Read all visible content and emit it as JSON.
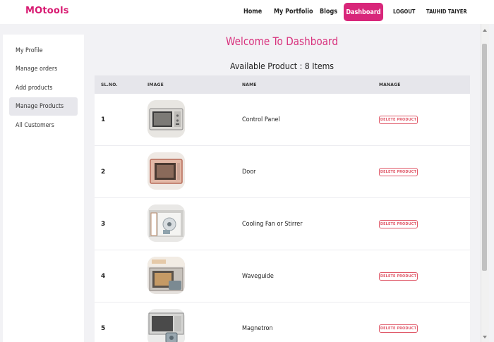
{
  "navbar": {
    "brand": "MOtools",
    "links": {
      "home": "Home",
      "portfolio": "My Portfolio",
      "blogs": "Blogs",
      "dashboard": "Dashboard",
      "logout": "LOGOUT",
      "user": "TAUHID TAIYER"
    }
  },
  "sidebar": {
    "items": [
      {
        "label": "My Profile"
      },
      {
        "label": "Manage orders"
      },
      {
        "label": "Add products"
      },
      {
        "label": "Manage Products",
        "active": true
      },
      {
        "label": "All Customers"
      }
    ]
  },
  "main": {
    "title": "Welcome To Dashboard",
    "subtitle": "Available Product : 8 Items"
  },
  "table": {
    "headers": {
      "slno": "SL.NO.",
      "image": "IMAGE",
      "name": "NAME",
      "manage": "MANAGE"
    },
    "rows": [
      {
        "num": "1",
        "name": "Control Panel",
        "action": "DELETE PRODUCT"
      },
      {
        "num": "2",
        "name": "Door",
        "action": "DELETE PRODUCT"
      },
      {
        "num": "3",
        "name": "Cooling Fan or Stirrer",
        "action": "DELETE PRODUCT"
      },
      {
        "num": "4",
        "name": "Waveguide",
        "action": "DELETE PRODUCT"
      },
      {
        "num": "5",
        "name": "Magnetron",
        "action": "DELETE PRODUCT"
      }
    ]
  },
  "colors": {
    "brand": "#d81b72",
    "accent": "#d8267a",
    "danger": "#e05a6a"
  }
}
